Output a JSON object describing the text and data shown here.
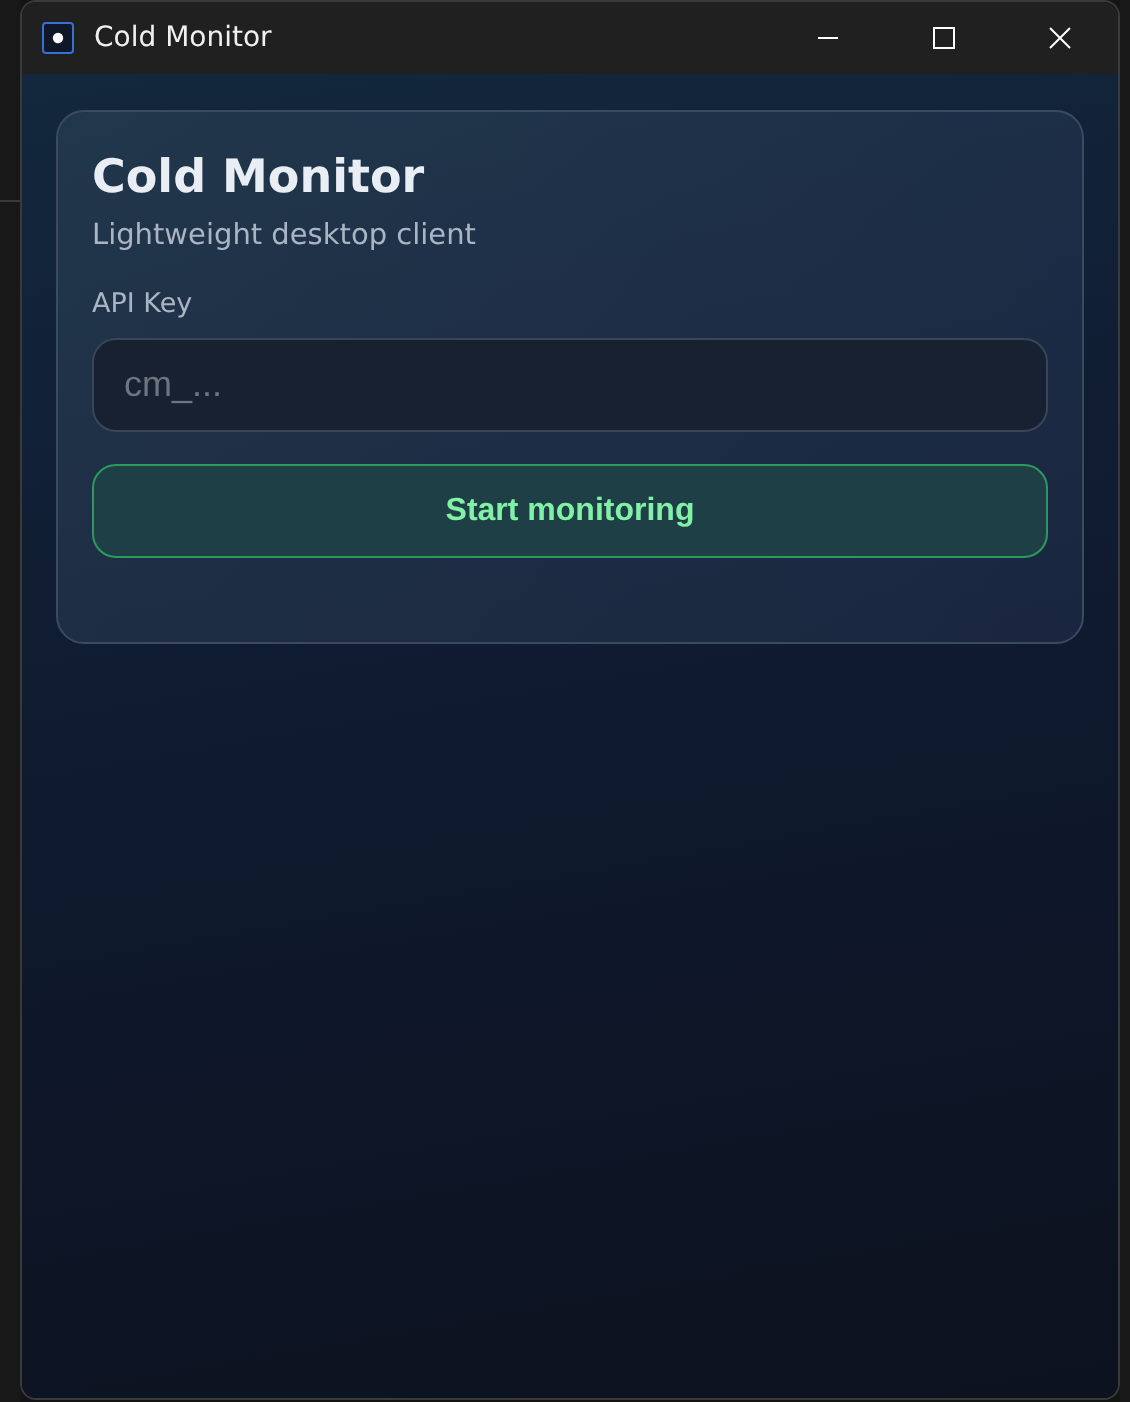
{
  "window": {
    "title": "Cold Monitor"
  },
  "card": {
    "title": "Cold Monitor",
    "subtitle": "Lightweight desktop client",
    "api_key": {
      "label": "API Key",
      "placeholder": "cm_..."
    },
    "button": "Start monitoring"
  }
}
